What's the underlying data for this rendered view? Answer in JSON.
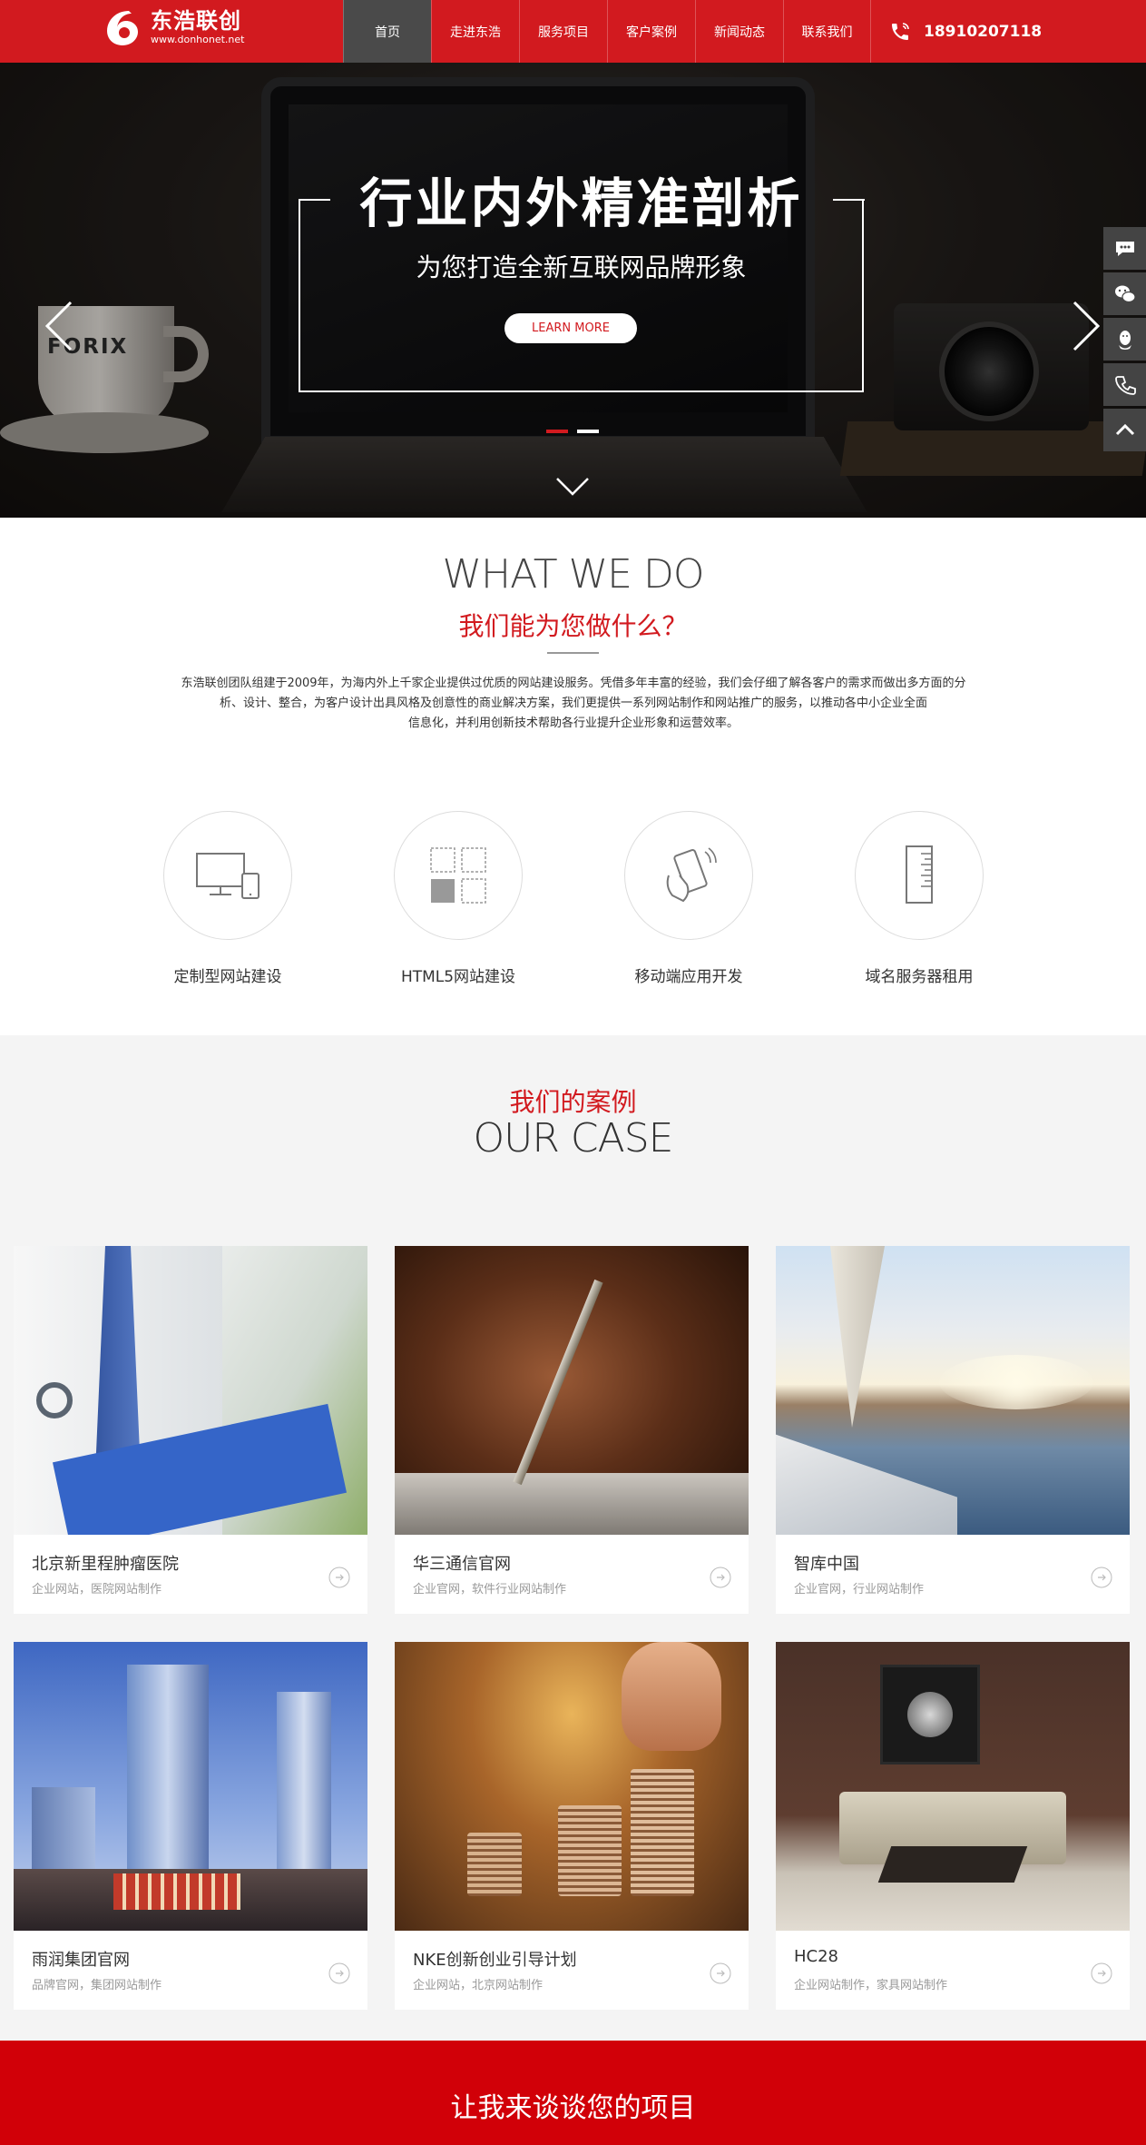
{
  "header": {
    "logo_cn": "东浩联创",
    "logo_url": "www.donhonet.net",
    "nav": [
      "首页",
      "走进东浩",
      "服务项目",
      "客户案例",
      "新闻动态",
      "联系我们"
    ],
    "active_nav": "首页",
    "phone": "18910207118"
  },
  "hero": {
    "title": "行业内外精准剖析",
    "subtitle": "为您打造全新互联网品牌形象",
    "button": "LEARN MORE",
    "cup_brand": "FORIX",
    "slides_count": 2,
    "active_slide": 1
  },
  "colors": {
    "brand_red": "#d21a1f",
    "nav_active": "#4a4a4a",
    "band_red": "#d10008"
  },
  "side_tools": [
    "chat-icon",
    "wechat-icon",
    "qq-icon",
    "phone-icon",
    "back-to-top-icon"
  ],
  "what_we_do": {
    "title": "WHAT WE DO",
    "subtitle": "我们能为您做什么？",
    "intro_line1": "东浩联创团队组建于2009年，为海内外上千家企业提供过优质的网站建设服务。凭借多年丰富的经验，我们会仔细了解各客户的需求而做出多方面的分析、设计、整合，为客户设计出具风格及创意性的商业解决方案，我们更提供一系列网站制作和网站推广的服务，以推动各中小企业全面",
    "intro_line2": "信息化，并利用创新技术帮助各行业提升企业形象和运营效率。",
    "services": [
      {
        "label": "定制型网站建设",
        "icon": "desktop-mobile-icon"
      },
      {
        "label": "HTML5网站建设",
        "icon": "html5-grid-icon"
      },
      {
        "label": "移动端应用开发",
        "icon": "mobile-touch-icon"
      },
      {
        "label": "域名服务器租用",
        "icon": "server-icon"
      }
    ]
  },
  "cases": {
    "title_cn": "我们的案例",
    "title_en": "OUR CASE",
    "items": [
      {
        "name": "北京新里程肿瘤医院",
        "tags": "企业网站，医院网站制作",
        "image": "doctor-clipboard-image"
      },
      {
        "name": "华三通信官网",
        "tags": "企业官网，软件行业网站制作",
        "image": "hand-pen-image"
      },
      {
        "name": "智库中国",
        "tags": "企业官网，行业网站制作",
        "image": "sailboat-sunset-image"
      },
      {
        "name": "雨润集团官网",
        "tags": "品牌官网，集团网站制作",
        "image": "skyscrapers-image"
      },
      {
        "name": "NKE创新创业引导计划",
        "tags": "企业网站，北京网站制作",
        "image": "coin-stacks-image"
      },
      {
        "name": "HC28",
        "tags": "企业网站制作，家具网站制作",
        "image": "sofa-interior-image"
      }
    ]
  },
  "footer_band": {
    "text": "让我来谈谈您的项目"
  }
}
